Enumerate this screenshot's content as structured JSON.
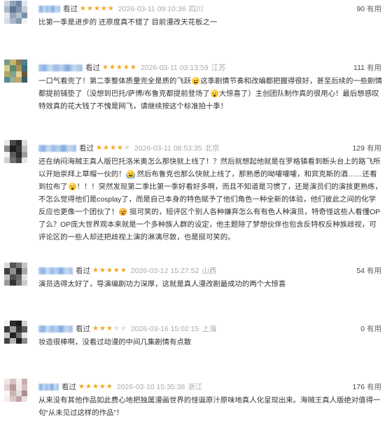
{
  "theme": {
    "star": "#f5a623",
    "star_empty": "#dcdcdc",
    "text": "#333333",
    "meta": "#aaaaaa",
    "username_blur": "#8fb3e3"
  },
  "ui": {
    "useful_label": "有用",
    "rating_max": 5
  },
  "comments": [
    {
      "avatar_colors": [
        "#c9d3de",
        "#8fa3b8",
        "#6d87a3",
        "#dfe5ec",
        "#a9b8c8",
        "#5f7894",
        "#7f95ad",
        "#c2ccd7",
        "#e6eaef",
        "#94a6ba",
        "#b5c2d0",
        "#7a8fa6",
        "#d5dce4",
        "#aab7c6",
        "#8699ae",
        "#eef1f4"
      ],
      "status": "看过",
      "rating": 5,
      "date": "2026-03-11 09:10:36",
      "location": "四川",
      "votes": "90",
      "segments": [
        {
          "text": "比第一季是进步的 还原度真不错了 目前漫改天花板之一"
        }
      ]
    },
    {
      "avatar_colors": [
        "#6f9c8a",
        "#c6b46a",
        "#8b7a4a",
        "#4d7f8c",
        "#d8c98a",
        "#5b8c6f",
        "#a8935a",
        "#3f6f7d",
        "#b9a463",
        "#7fa38e",
        "#e0d29a",
        "#6a5a3a",
        "#4f8a9a",
        "#9bb08a",
        "#c4a86a",
        "#2f5f6a"
      ],
      "status": "看过",
      "rating": 5,
      "date": "2026-03-11 03:13:59",
      "location": "江苏",
      "votes": "111",
      "segments": [
        {
          "text": "一口气看完了！第二季整体质量完全是质的飞跃"
        },
        {
          "emoji": "grinning-face"
        },
        {
          "text": "这季剧情节奏和改编都把握得很好，甚至后续的一些剧情都提前铺垫了（没想到巴托/萨博/布鲁克都提前登场了"
        },
        {
          "emoji": "astonished-face"
        },
        {
          "text": "大惊喜了）主创团队制作真的很用心！最后想感叹特效真的花大钱了不愧是网飞，请继续按这个标准拍十季！"
        }
      ]
    },
    {
      "avatar_colors": [
        "#e8e8e8",
        "#4a4a4a",
        "#2a2a2a",
        "#dcdcdc",
        "#8a8a8a",
        "#1f1f1f",
        "#3a3a3a",
        "#bdbdbd",
        "#f2f2f2",
        "#5c5c5c",
        "#2e2e2e",
        "#9c9c9c",
        "#cfcfcf",
        "#6e6e6e",
        "#474747",
        "#e5e5e5"
      ],
      "status": "看过",
      "rating": 4,
      "date": "2026-03-11 08:53:35",
      "location": "北京",
      "votes": "129",
      "segments": [
        {
          "text": "还在纳闷海贼王真人版巴托洛米奥怎么那快就上线了！？然后就想起他就是在罗格镇看到断头台上的路飞所以开始崇拜上草帽一伙的！"
        },
        {
          "emoji": "face-with-tears-of-joy"
        },
        {
          "text": " 然后布鲁克也那么快就上线了，那熟悉的呦嚯嚯嚯，和宾克斯的酒……还看到拉布了"
        },
        {
          "emoji": "astonished-face"
        },
        {
          "text": "！！！突然发现第二季比第一季好看好多啊，而且不知道是习惯了，还是演员们的演技更熟练，不怎么觉得他们是cosplay了，而是自己本身的特色赋予了他们角色一种全新的体验，他们彼此之间的化学反应也更像一个团伙了！"
        },
        {
          "emoji": "flushed-face"
        },
        {
          "text": " 挺可笑的，短评区个别人各种嫌弃怎么有有色人种演员，特奇怪这些人看懂OP了么？OP庞大世界观本来就是一个多种族人群的设定，他主题除了梦想伙伴也包含反特权反种族歧视，可评论区的一些人却还把歧视上演的淋漓尽致，也是挺可笑的。"
        }
      ]
    },
    {
      "avatar_colors": [
        "#d9d9d9",
        "#555555",
        "#7a7a7a",
        "#c4c4c4",
        "#3d3d3d",
        "#8f8f8f",
        "#2b2b2b",
        "#a8a8a8",
        "#bfbfbf",
        "#4f4f4f",
        "#6a6a6a",
        "#e0e0e0",
        "#9a9a9a",
        "#333333",
        "#777777",
        "#cccccc"
      ],
      "status": "看过",
      "rating": 5,
      "date": "2026-03-12 15:27:52",
      "location": "山西",
      "votes": "54",
      "segments": [
        {
          "text": "演员选得太好了，导演编剧功力深厚，这就是真人漫改剧最成功的两个大惊喜"
        }
      ]
    },
    {
      "avatar_colors": [
        "#f0f0f0",
        "#2a2a2a",
        "#1c1c1c",
        "#d0d0d0",
        "#3b3b3b",
        "#9e9e9e",
        "#2f2f2f",
        "#5a5a5a",
        "#c8c8c8",
        "#222222",
        "#6f6f6f",
        "#e6e6e6",
        "#444444",
        "#b4b4b4",
        "#1e1e1e",
        "#8a8a8a"
      ],
      "status": "看过",
      "rating": 3,
      "date": "2026-03-16 15:02:15",
      "location": "上海",
      "votes": "0",
      "segments": [
        {
          "text": "妆造很棒啊，没看过动漫的中间几集剧情有点散"
        }
      ]
    },
    {
      "avatar_colors": [
        "#efe6e6",
        "#d9c2c4",
        "#f7f1f1",
        "#c9aeb0",
        "#e4d2d3",
        "#b89a9c",
        "#f2eaea",
        "#d6c0c1",
        "#faf6f6",
        "#cdb3b5",
        "#e9dcdd",
        "#a88e90",
        "#f4eded",
        "#dcc8c9",
        "#c1a5a7",
        "#ece2e2"
      ],
      "status": "看过",
      "rating": 5,
      "date": "2026-03-10 15:35:38",
      "location": "浙江",
      "votes": "176",
      "segments": [
        {
          "text": "从来没有其他作品如此费心地把独属漫画世界的怪诞原汁原味地真人化呈现出来。海贼王真人版绝对值得一句“从未见过这样的作品”！"
        }
      ]
    }
  ]
}
